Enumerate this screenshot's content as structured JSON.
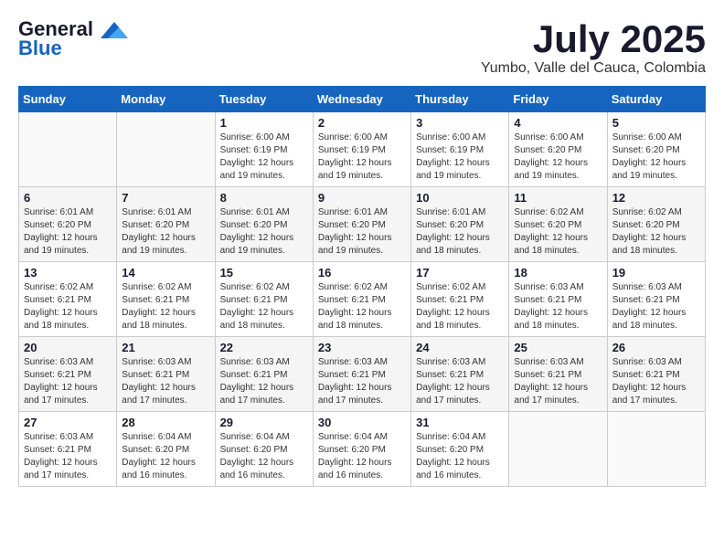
{
  "header": {
    "logo_line1": "General",
    "logo_line2": "Blue",
    "month": "July 2025",
    "location": "Yumbo, Valle del Cauca, Colombia"
  },
  "weekdays": [
    "Sunday",
    "Monday",
    "Tuesday",
    "Wednesday",
    "Thursday",
    "Friday",
    "Saturday"
  ],
  "weeks": [
    [
      {
        "day": "",
        "sunrise": "",
        "sunset": "",
        "daylight": ""
      },
      {
        "day": "",
        "sunrise": "",
        "sunset": "",
        "daylight": ""
      },
      {
        "day": "1",
        "sunrise": "Sunrise: 6:00 AM",
        "sunset": "Sunset: 6:19 PM",
        "daylight": "Daylight: 12 hours and 19 minutes."
      },
      {
        "day": "2",
        "sunrise": "Sunrise: 6:00 AM",
        "sunset": "Sunset: 6:19 PM",
        "daylight": "Daylight: 12 hours and 19 minutes."
      },
      {
        "day": "3",
        "sunrise": "Sunrise: 6:00 AM",
        "sunset": "Sunset: 6:19 PM",
        "daylight": "Daylight: 12 hours and 19 minutes."
      },
      {
        "day": "4",
        "sunrise": "Sunrise: 6:00 AM",
        "sunset": "Sunset: 6:20 PM",
        "daylight": "Daylight: 12 hours and 19 minutes."
      },
      {
        "day": "5",
        "sunrise": "Sunrise: 6:00 AM",
        "sunset": "Sunset: 6:20 PM",
        "daylight": "Daylight: 12 hours and 19 minutes."
      }
    ],
    [
      {
        "day": "6",
        "sunrise": "Sunrise: 6:01 AM",
        "sunset": "Sunset: 6:20 PM",
        "daylight": "Daylight: 12 hours and 19 minutes."
      },
      {
        "day": "7",
        "sunrise": "Sunrise: 6:01 AM",
        "sunset": "Sunset: 6:20 PM",
        "daylight": "Daylight: 12 hours and 19 minutes."
      },
      {
        "day": "8",
        "sunrise": "Sunrise: 6:01 AM",
        "sunset": "Sunset: 6:20 PM",
        "daylight": "Daylight: 12 hours and 19 minutes."
      },
      {
        "day": "9",
        "sunrise": "Sunrise: 6:01 AM",
        "sunset": "Sunset: 6:20 PM",
        "daylight": "Daylight: 12 hours and 19 minutes."
      },
      {
        "day": "10",
        "sunrise": "Sunrise: 6:01 AM",
        "sunset": "Sunset: 6:20 PM",
        "daylight": "Daylight: 12 hours and 18 minutes."
      },
      {
        "day": "11",
        "sunrise": "Sunrise: 6:02 AM",
        "sunset": "Sunset: 6:20 PM",
        "daylight": "Daylight: 12 hours and 18 minutes."
      },
      {
        "day": "12",
        "sunrise": "Sunrise: 6:02 AM",
        "sunset": "Sunset: 6:20 PM",
        "daylight": "Daylight: 12 hours and 18 minutes."
      }
    ],
    [
      {
        "day": "13",
        "sunrise": "Sunrise: 6:02 AM",
        "sunset": "Sunset: 6:21 PM",
        "daylight": "Daylight: 12 hours and 18 minutes."
      },
      {
        "day": "14",
        "sunrise": "Sunrise: 6:02 AM",
        "sunset": "Sunset: 6:21 PM",
        "daylight": "Daylight: 12 hours and 18 minutes."
      },
      {
        "day": "15",
        "sunrise": "Sunrise: 6:02 AM",
        "sunset": "Sunset: 6:21 PM",
        "daylight": "Daylight: 12 hours and 18 minutes."
      },
      {
        "day": "16",
        "sunrise": "Sunrise: 6:02 AM",
        "sunset": "Sunset: 6:21 PM",
        "daylight": "Daylight: 12 hours and 18 minutes."
      },
      {
        "day": "17",
        "sunrise": "Sunrise: 6:02 AM",
        "sunset": "Sunset: 6:21 PM",
        "daylight": "Daylight: 12 hours and 18 minutes."
      },
      {
        "day": "18",
        "sunrise": "Sunrise: 6:03 AM",
        "sunset": "Sunset: 6:21 PM",
        "daylight": "Daylight: 12 hours and 18 minutes."
      },
      {
        "day": "19",
        "sunrise": "Sunrise: 6:03 AM",
        "sunset": "Sunset: 6:21 PM",
        "daylight": "Daylight: 12 hours and 18 minutes."
      }
    ],
    [
      {
        "day": "20",
        "sunrise": "Sunrise: 6:03 AM",
        "sunset": "Sunset: 6:21 PM",
        "daylight": "Daylight: 12 hours and 17 minutes."
      },
      {
        "day": "21",
        "sunrise": "Sunrise: 6:03 AM",
        "sunset": "Sunset: 6:21 PM",
        "daylight": "Daylight: 12 hours and 17 minutes."
      },
      {
        "day": "22",
        "sunrise": "Sunrise: 6:03 AM",
        "sunset": "Sunset: 6:21 PM",
        "daylight": "Daylight: 12 hours and 17 minutes."
      },
      {
        "day": "23",
        "sunrise": "Sunrise: 6:03 AM",
        "sunset": "Sunset: 6:21 PM",
        "daylight": "Daylight: 12 hours and 17 minutes."
      },
      {
        "day": "24",
        "sunrise": "Sunrise: 6:03 AM",
        "sunset": "Sunset: 6:21 PM",
        "daylight": "Daylight: 12 hours and 17 minutes."
      },
      {
        "day": "25",
        "sunrise": "Sunrise: 6:03 AM",
        "sunset": "Sunset: 6:21 PM",
        "daylight": "Daylight: 12 hours and 17 minutes."
      },
      {
        "day": "26",
        "sunrise": "Sunrise: 6:03 AM",
        "sunset": "Sunset: 6:21 PM",
        "daylight": "Daylight: 12 hours and 17 minutes."
      }
    ],
    [
      {
        "day": "27",
        "sunrise": "Sunrise: 6:03 AM",
        "sunset": "Sunset: 6:21 PM",
        "daylight": "Daylight: 12 hours and 17 minutes."
      },
      {
        "day": "28",
        "sunrise": "Sunrise: 6:04 AM",
        "sunset": "Sunset: 6:20 PM",
        "daylight": "Daylight: 12 hours and 16 minutes."
      },
      {
        "day": "29",
        "sunrise": "Sunrise: 6:04 AM",
        "sunset": "Sunset: 6:20 PM",
        "daylight": "Daylight: 12 hours and 16 minutes."
      },
      {
        "day": "30",
        "sunrise": "Sunrise: 6:04 AM",
        "sunset": "Sunset: 6:20 PM",
        "daylight": "Daylight: 12 hours and 16 minutes."
      },
      {
        "day": "31",
        "sunrise": "Sunrise: 6:04 AM",
        "sunset": "Sunset: 6:20 PM",
        "daylight": "Daylight: 12 hours and 16 minutes."
      },
      {
        "day": "",
        "sunrise": "",
        "sunset": "",
        "daylight": ""
      },
      {
        "day": "",
        "sunrise": "",
        "sunset": "",
        "daylight": ""
      }
    ]
  ]
}
